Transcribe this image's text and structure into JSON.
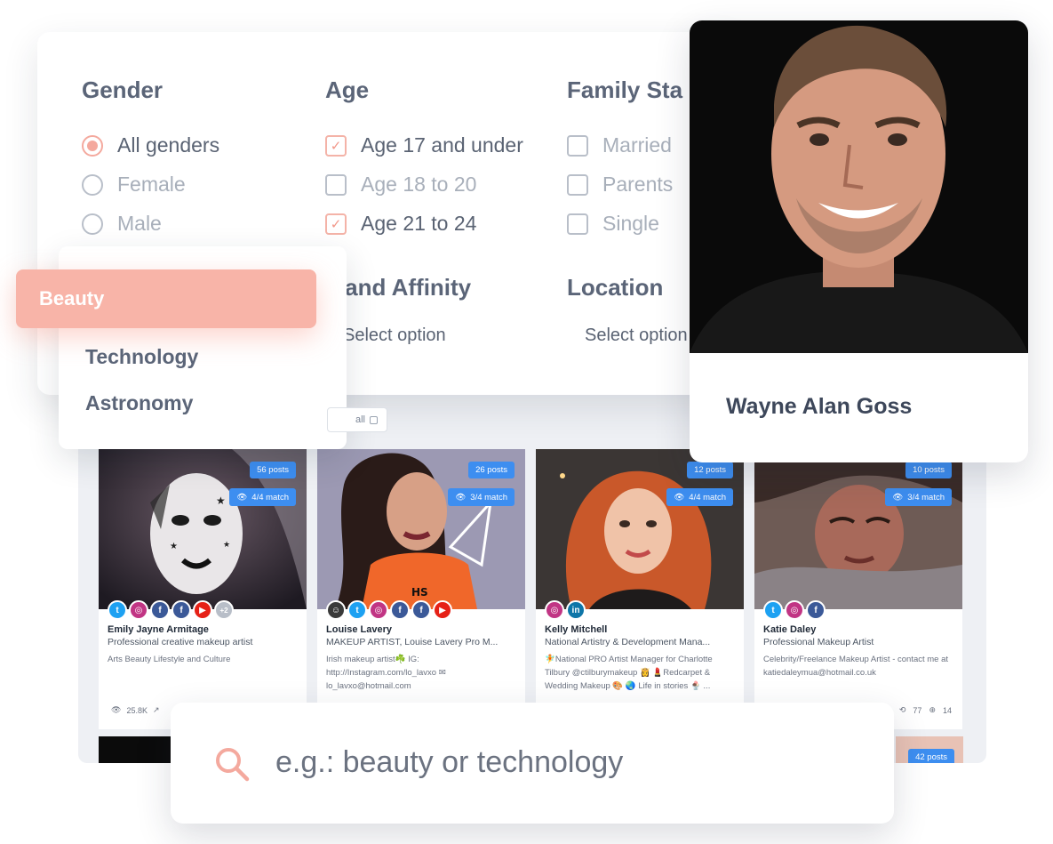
{
  "filters": {
    "gender": {
      "title": "Gender",
      "options": [
        {
          "label": "All genders",
          "selected": true
        },
        {
          "label": "Female",
          "selected": false
        },
        {
          "label": "Male",
          "selected": false
        }
      ]
    },
    "age": {
      "title": "Age",
      "options": [
        {
          "label": "Age 17 and under",
          "checked": true
        },
        {
          "label": "Age 18 to 20",
          "checked": false
        },
        {
          "label": "Age 21 to 24",
          "checked": true
        }
      ]
    },
    "family": {
      "title": "Family Sta",
      "options": [
        {
          "label": "Married",
          "checked": false
        },
        {
          "label": "Parents",
          "checked": false
        },
        {
          "label": "Single",
          "checked": false
        }
      ]
    },
    "brand_affinity": {
      "title": "rand Affinity",
      "placeholder": "Select option"
    },
    "location": {
      "title": "Location",
      "placeholder": "Select option"
    }
  },
  "categories": {
    "active": "Beauty",
    "items": [
      "Technology",
      "Astronomy"
    ]
  },
  "select_all_label": "all",
  "profile": {
    "name": "Wayne Alan Goss"
  },
  "influencers": [
    {
      "posts": "56 posts",
      "match": "4/4 match",
      "name": "Emily Jayne Armitage",
      "role": "Professional creative makeup artist",
      "bio": "Arts Beauty Lifestyle and Culture",
      "socials": [
        "tw",
        "ig",
        "fb",
        "fb",
        "yt"
      ],
      "more": "+2",
      "views": "25.8K"
    },
    {
      "posts": "26 posts",
      "match": "3/4 match",
      "name": "Louise Lavery",
      "role": "MAKEUP ARTIST, Louise Lavery Pro M...",
      "bio": "Irish makeup artist☘️ IG: http://Instagram.com/lo_lavxo ✉ lo_lavxo@hotmail.com",
      "socials": [
        "sc",
        "tw",
        "ig",
        "fb",
        "fb",
        "yt"
      ]
    },
    {
      "posts": "12 posts",
      "match": "4/4 match",
      "name": "Kelly Mitchell",
      "role": "National Artistry & Development Mana...",
      "bio": "🧚National PRO Artist Manager for Charlotte Tilbury @ctilburymakeup 👸 💄Redcarpet & Wedding Makeup 🎨 🌏 Life in stories 🍨 ...",
      "socials": [
        "ig",
        "li"
      ]
    },
    {
      "posts": "10 posts",
      "match": "3/4 match",
      "name": "Katie Daley",
      "role": "Professional Makeup Artist",
      "bio": "Celebrity/Freelance Makeup Artist - contact me at katiedaleymua@hotmail.co.uk",
      "socials": [
        "tw",
        "ig",
        "fb"
      ],
      "shares": "77",
      "reach": "14"
    }
  ],
  "extra_card_posts": "42 posts",
  "search": {
    "placeholder": "e.g.: beauty or technology"
  },
  "colors": {
    "accent": "#f8b4a8",
    "pill": "#3d8ef0",
    "heading": "#5b6578"
  }
}
